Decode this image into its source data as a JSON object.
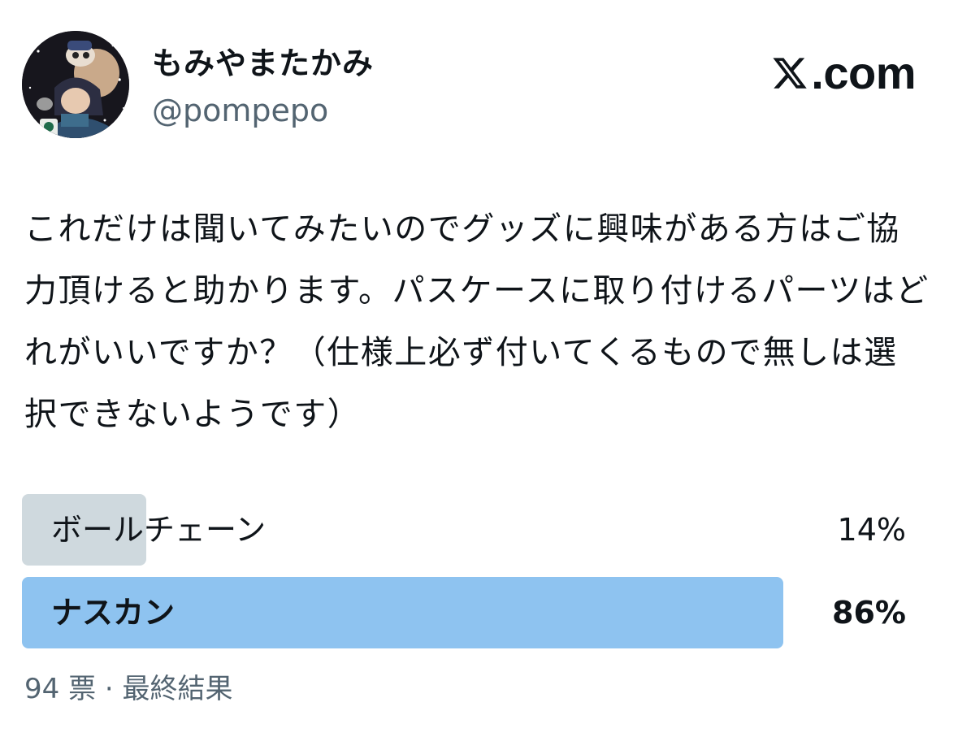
{
  "author": {
    "display_name": "もみやまたかみ",
    "handle": "@pompepo"
  },
  "brand": {
    "text": ".com",
    "icon": "x-logo-icon"
  },
  "post": {
    "text": "これだけは聞いてみたいのでグッズに興味がある方はご協力頂けると助かります。パスケースに取り付けるパーツはどれがいいですか？（仕様上必ず付いてくるもので無しは選択できないようです）"
  },
  "poll": {
    "options": [
      {
        "label": "ボールチェーン",
        "percent_label": "14%",
        "fraction": 0.14,
        "winner": false
      },
      {
        "label": "ナスカン",
        "percent_label": "86%",
        "fraction": 0.86,
        "winner": true
      }
    ],
    "votes": "94 票",
    "separator": "·",
    "status": "最終結果"
  },
  "colors": {
    "winner_bar": "#8ec3f0",
    "loser_bar": "#cfd9de",
    "secondary_text": "#536471",
    "primary_text": "#0f1419"
  }
}
